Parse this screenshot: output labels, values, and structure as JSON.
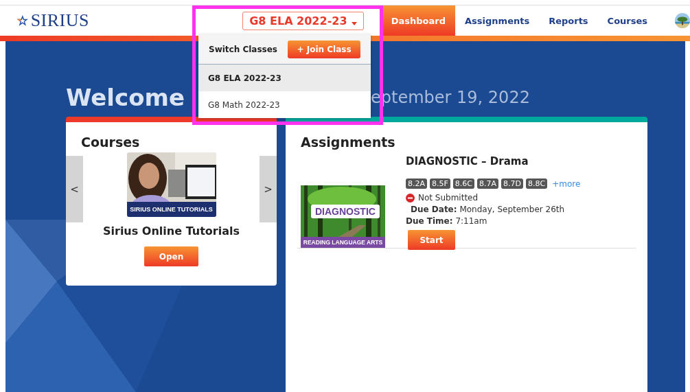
{
  "header": {
    "logo": "SIRIUS",
    "class_selector": "G8 ELA 2022-23",
    "nav": [
      {
        "label": "Dashboard",
        "selected": true
      },
      {
        "label": "Assignments",
        "selected": false
      },
      {
        "label": "Reports",
        "selected": false
      },
      {
        "label": "Courses",
        "selected": false
      }
    ]
  },
  "class_menu": {
    "title": "Switch Classes",
    "join_button": "+ Join Class",
    "classes": [
      {
        "label": "G8 ELA 2022-23",
        "selected": true
      },
      {
        "label": "G8 Math 2022-23",
        "selected": false
      }
    ]
  },
  "welcome": {
    "greeting": "Welcome",
    "date": "eptember 19, 2022"
  },
  "courses": {
    "title": "Courses",
    "prev": "<",
    "next": ">",
    "course": {
      "thumbnail_caption": "SIRIUS ONLINE TUTORIALS",
      "name": "Sirius Online Tutorials",
      "button": "Open"
    }
  },
  "assignments": {
    "title": "Assignments",
    "items": [
      {
        "title": "DIAGNOSTIC – Drama",
        "thumbnail_label": "DIAGNOSTIC",
        "thumbnail_caption": "READING LANGUAGE ARTS",
        "standards": [
          "8.2A",
          "8.5F",
          "8.6C",
          "8.7A",
          "8.7D",
          "8.8C"
        ],
        "more": "+more",
        "status": "Not Submitted",
        "due_date_label": "Due Date:",
        "due_date": "Monday, September 26th",
        "due_time_label": "Due Time:",
        "due_time": "7:11am",
        "button": "Start"
      }
    ]
  }
}
